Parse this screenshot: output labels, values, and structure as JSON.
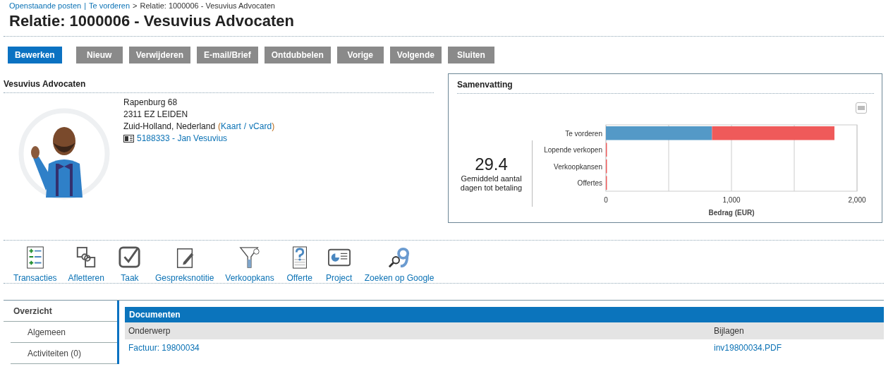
{
  "breadcrumb": {
    "links": [
      "Openstaande posten",
      "Te vorderen"
    ],
    "separator": "|",
    "arrow": ">",
    "current": "Relatie: 1000006 - Vesuvius Advocaten"
  },
  "title": "Relatie: 1000006 - Vesuvius Advocaten",
  "buttons": [
    {
      "label": "Bewerken",
      "kind": "primary"
    },
    {
      "label": "Nieuw",
      "kind": "secondary"
    },
    {
      "label": "Verwijderen",
      "kind": "secondary"
    },
    {
      "label": "E-mail/Brief",
      "kind": "secondary"
    },
    {
      "label": "Ontdubbelen",
      "kind": "secondary"
    },
    {
      "label": "Vorige",
      "kind": "secondary"
    },
    {
      "label": "Volgende",
      "kind": "secondary"
    },
    {
      "label": "Sluiten",
      "kind": "secondary"
    }
  ],
  "contact": {
    "heading": "Vesuvius Advocaten",
    "address": [
      "Rapenburg 68",
      "2311 EZ LEIDEN"
    ],
    "region": "Zuid-Holland, Nederland",
    "open_paren": "(",
    "links": [
      "Kaart",
      "vCard"
    ],
    "link_separator": "/",
    "close_paren": ")",
    "person": "5188333 - Jan Vesuvius"
  },
  "summary": {
    "heading": "Samenvatting",
    "kpi_value": "29.4",
    "kpi_label": "Gemiddeld aantal dagen tot betaling",
    "chart_data": {
      "type": "bar",
      "orientation": "horizontal",
      "stacked": true,
      "xlabel": "Bedrag (EUR)",
      "categories": [
        "Te vorderen",
        "Lopende verkopen",
        "Verkoopkansen",
        "Offertes"
      ],
      "series": [
        {
          "color": "#5499c7",
          "values": [
            845,
            0,
            0,
            0
          ]
        },
        {
          "color": "#ef5a5a",
          "values": [
            975,
            8,
            8,
            8
          ]
        }
      ],
      "xlim": [
        0,
        2000
      ],
      "xticks": [
        {
          "value": 0,
          "label": "0"
        },
        {
          "value": 1000,
          "label": "1,000"
        },
        {
          "value": 2000,
          "label": "2,000"
        }
      ]
    }
  },
  "actions": [
    "Transacties",
    "Afletteren",
    "Taak",
    "Gespreksnotitie",
    "Verkoopkans",
    "Offerte",
    "Project",
    "Zoeken op Google"
  ],
  "sidebar": {
    "items": [
      {
        "label": "Overzicht",
        "selected": true
      },
      {
        "label": "Algemeen",
        "selected": false
      },
      {
        "label": "Activiteiten (0)",
        "selected": false
      }
    ]
  },
  "documents": {
    "heading": "Documenten",
    "columns": [
      "Onderwerp",
      "Bijlagen"
    ],
    "rows": [
      [
        "Factuur: 19800034",
        "inv19800034.PDF"
      ]
    ]
  }
}
